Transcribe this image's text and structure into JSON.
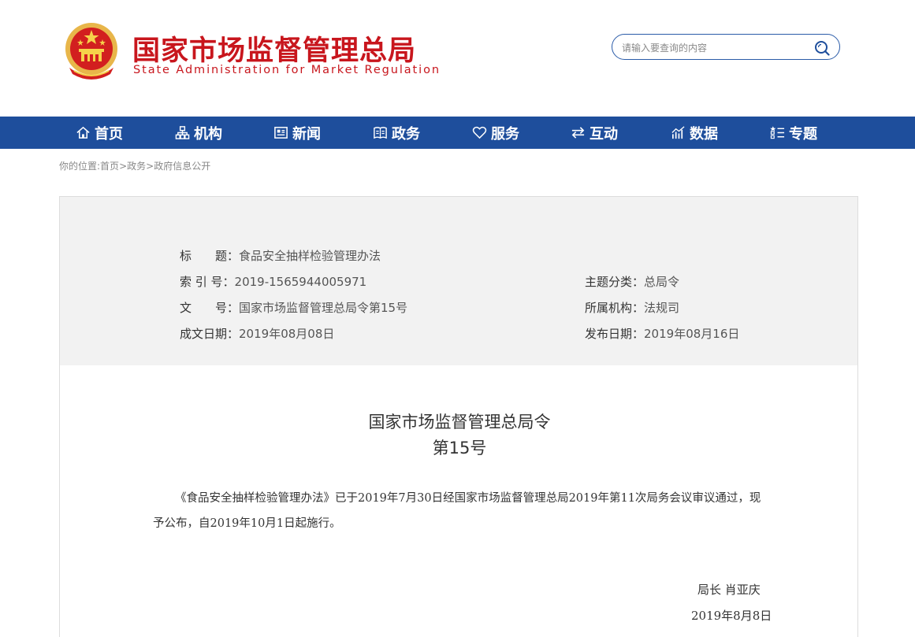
{
  "header": {
    "title": "国家市场监督管理总局",
    "subtitle": "State Administration for Market Regulation"
  },
  "search": {
    "placeholder": "请输入要查询的内容"
  },
  "nav": {
    "items": [
      {
        "label": "首页",
        "icon": "home-icon"
      },
      {
        "label": "机构",
        "icon": "org-icon"
      },
      {
        "label": "新闻",
        "icon": "news-icon"
      },
      {
        "label": "政务",
        "icon": "affairs-icon"
      },
      {
        "label": "服务",
        "icon": "heart-icon"
      },
      {
        "label": "互动",
        "icon": "exchange-icon"
      },
      {
        "label": "数据",
        "icon": "chart-icon"
      },
      {
        "label": "专题",
        "icon": "topics-icon"
      }
    ]
  },
  "breadcrumb": {
    "prefix": "你的位置:",
    "items": [
      "首页",
      "政务",
      "政府信息公开"
    ],
    "separator": ">"
  },
  "meta": {
    "title_key": "标　　题：",
    "title_val": "食品安全抽样检验管理办法",
    "index_key": "索 引 号：",
    "index_val": "2019-1565944005971",
    "docno_key": "文　　号：",
    "docno_val": "国家市场监督管理总局令第15号",
    "date_key": "成文日期：",
    "date_val": "2019年08月08日",
    "topic_key": "主题分类：",
    "topic_val": "总局令",
    "org_key": "所属机构：",
    "org_val": "法规司",
    "pub_key": "发布日期：",
    "pub_val": "2019年08月16日"
  },
  "document": {
    "title": "国家市场监督管理总局令",
    "number": "第15号",
    "body": "《食品安全抽样检验管理办法》已于2019年7月30日经国家市场监督管理总局2019年第11次局务会议审议通过，现予公布，自2019年10月1日起施行。",
    "signer": "局长  肖亚庆",
    "date": "2019年8月8日"
  },
  "colors": {
    "brand_red": "#c8161d",
    "nav_blue": "#1e4e9c"
  }
}
